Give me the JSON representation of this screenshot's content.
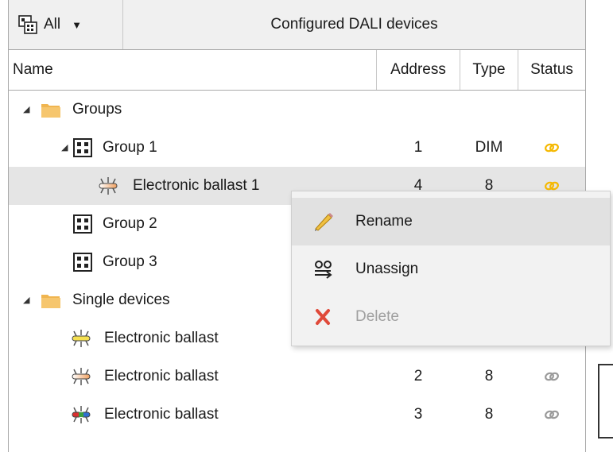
{
  "toolbar": {
    "filter_label": "All",
    "filter_icon": "device-filter-icon",
    "title": "Configured DALI devices"
  },
  "columns": {
    "name": "Name",
    "address": "Address",
    "type": "Type",
    "status": "Status"
  },
  "tree": [
    {
      "label": "Groups",
      "icon": "folder-icon",
      "expander": "expanded",
      "address": "",
      "type": "",
      "status": ""
    },
    {
      "label": "Group 1",
      "icon": "group-icon",
      "expander": "expanded",
      "address": "1",
      "type": "DIM",
      "status": "linked"
    },
    {
      "label": "Electronic ballast 1",
      "icon": "ballast-orange-icon",
      "expander": "",
      "address": "4",
      "type": "8",
      "status": "linked",
      "selected": true
    },
    {
      "label": "Group 2",
      "icon": "group-icon",
      "expander": "",
      "address": "",
      "type": "",
      "status": ""
    },
    {
      "label": "Group 3",
      "icon": "group-icon",
      "expander": "",
      "address": "",
      "type": "",
      "status": ""
    },
    {
      "label": "Single devices",
      "icon": "folder-icon",
      "expander": "expanded",
      "address": "",
      "type": "",
      "status": ""
    },
    {
      "label": "Electronic ballast",
      "icon": "ballast-yellow-icon",
      "expander": "",
      "address": "",
      "type": "",
      "status": ""
    },
    {
      "label": "Electronic ballast",
      "icon": "ballast-orange-icon",
      "expander": "",
      "address": "2",
      "type": "8",
      "status": "unlinked"
    },
    {
      "label": "Electronic ballast",
      "icon": "ballast-rgb-icon",
      "expander": "",
      "address": "3",
      "type": "8",
      "status": "unlinked"
    }
  ],
  "context_menu": {
    "items": [
      {
        "label": "Rename",
        "icon": "pencil-icon",
        "enabled": true,
        "highlighted": true
      },
      {
        "label": "Unassign",
        "icon": "unassign-icon",
        "enabled": true,
        "highlighted": false
      },
      {
        "label": "Delete",
        "icon": "delete-x-icon",
        "enabled": false,
        "highlighted": false
      }
    ]
  },
  "colors": {
    "linked": "#f5b800",
    "unlinked": "#9a9a9a",
    "folder": "#f0b550",
    "delete": "#e04a3a",
    "selected_row": "#e5e5e5"
  }
}
